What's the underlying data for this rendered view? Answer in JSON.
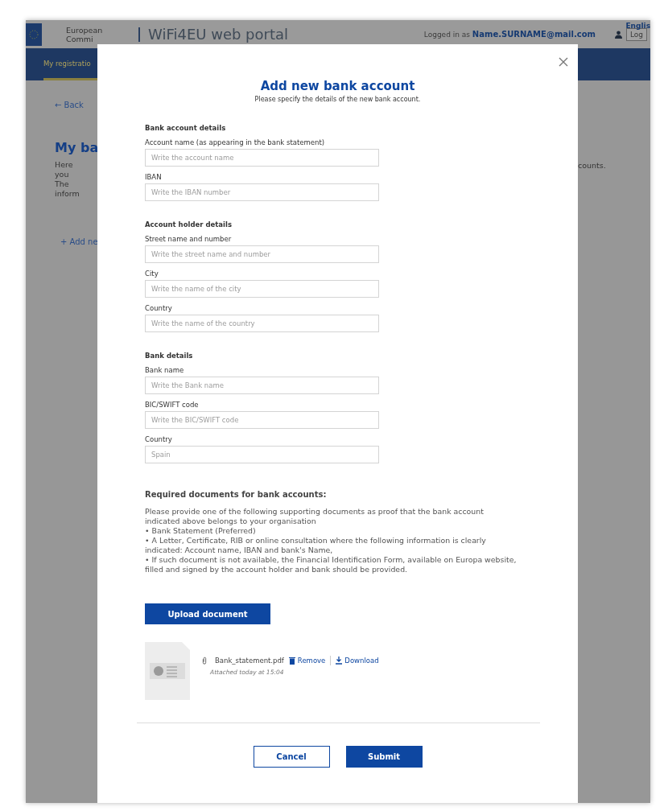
{
  "header": {
    "logo_lines": [
      "European",
      "Commi"
    ],
    "portal_title": "WiFi4EU web portal",
    "logged_in_label": "Logged in as",
    "user_email": "Name.SURNAME@mail.com",
    "logout_button": "Log",
    "language": "Englis"
  },
  "nav": {
    "items": [
      {
        "label": "My registratio",
        "selected": true
      }
    ]
  },
  "page": {
    "back_link": "← Back",
    "heading": "My ba",
    "intro_lines": [
      "Here you",
      "The inform"
    ],
    "intro_tail": "counts.",
    "add_link": "+ Add ne"
  },
  "modal": {
    "title": "Add new bank account",
    "subtitle": "Please specify the details of the new bank account.",
    "sections": [
      {
        "heading": "Bank account details",
        "fields": [
          {
            "label": "Account name (as appearing in the bank statement)",
            "placeholder": "Write the account name"
          },
          {
            "label": "IBAN",
            "placeholder": "Write the IBAN number"
          }
        ]
      },
      {
        "heading": "Account holder details",
        "fields": [
          {
            "label": "Street name and  number",
            "placeholder": "Write the street name and number"
          },
          {
            "label": "City",
            "placeholder": "Write the name of the city"
          },
          {
            "label": "Country",
            "placeholder": "Write the name of the country"
          }
        ]
      },
      {
        "heading": "Bank  details",
        "fields": [
          {
            "label": "Bank name",
            "placeholder": "Write the Bank name"
          },
          {
            "label": "BIC/SWIFT code",
            "placeholder": "Write the BIC/SWIFT code"
          },
          {
            "label": "Country",
            "placeholder": "Spain"
          }
        ]
      }
    ],
    "documents": {
      "heading": "Required documents for bank accounts:",
      "intro": "Please provide one of the following supporting documents as proof that the bank account indicated above belongs to your organisation",
      "bullets": [
        "• Bank Statement (Preferred)",
        "• A Letter, Certificate, RIB or online consultation where the following information is clearly indicated: Account name, IBAN and bank's Name,",
        "• If such document is not available, the Financial Identification Form, available on Europa website, filled and signed by the account holder and bank should be provided."
      ]
    },
    "upload_button": "Upload document",
    "attachment": {
      "file_name": "Bank_statement.pdf",
      "remove": "Remove",
      "download": "Download",
      "attached_note": "Attached today at 15:04"
    },
    "cancel_button": "Cancel",
    "submit_button": "Submit"
  }
}
